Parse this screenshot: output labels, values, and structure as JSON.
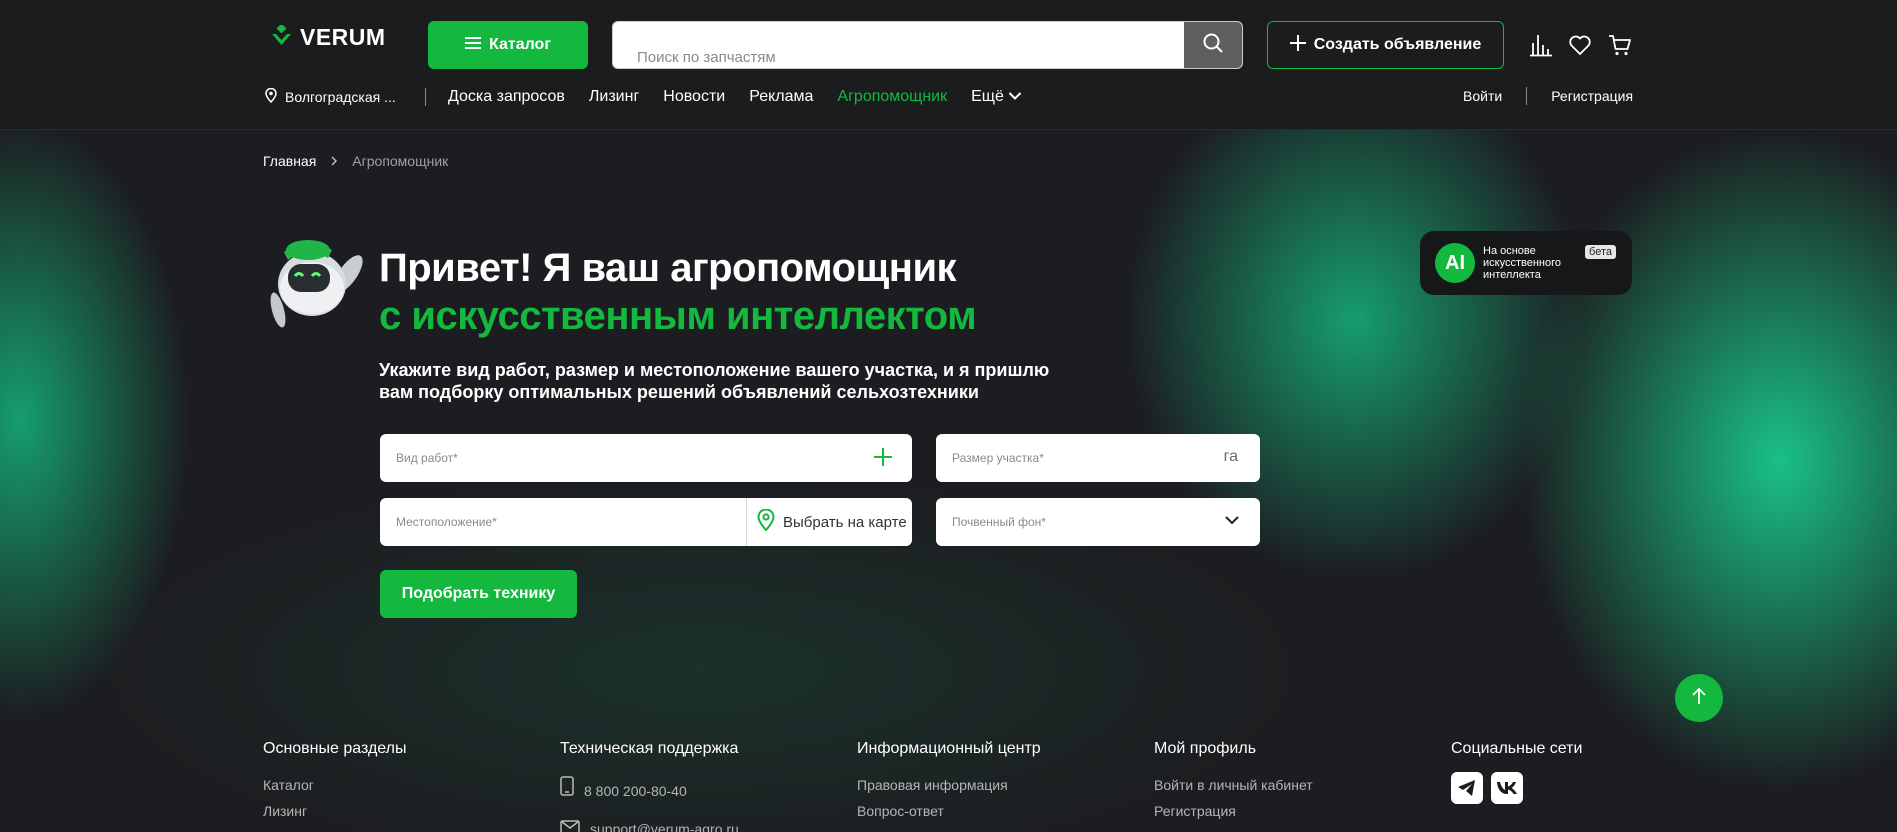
{
  "header": {
    "logo_text": "VERUM",
    "catalog_label": "Каталог",
    "search_placeholder": "Поиск по запчастям",
    "create_label": "Создать объявление",
    "region": "Волгоградская ...",
    "nav": [
      "Доска запросов",
      "Лизинг",
      "Новости",
      "Реклама",
      "Агропомощник"
    ],
    "nav_more": "Ещё",
    "login": "Войти",
    "register": "Регистрация"
  },
  "breadcrumb": {
    "home": "Главная",
    "current": "Агропомощник"
  },
  "hero": {
    "title_line1": "Привет! Я ваш агропомощник",
    "title_line2": "с искусственным интеллектом",
    "subtitle": "Укажите вид работ, размер и местоположение вашего участка, и я пришлю вам подборку оптимальных решений объявлений сельхозтехники"
  },
  "ai_badge": {
    "circle": "AI",
    "text": "На основе искусственного интеллекта",
    "beta": "бета"
  },
  "form": {
    "work_placeholder": "Вид работ*",
    "size_placeholder": "Размер участка*",
    "size_unit": "га",
    "location_placeholder": "Местоположение*",
    "map_label": "Выбрать на карте",
    "soil_placeholder": "Почвенный фон*",
    "submit_label": "Подобрать технику"
  },
  "footer": {
    "sections_title": "Основные разделы",
    "sections": [
      "Каталог",
      "Лизинг"
    ],
    "support_title": "Техническая поддержка",
    "phone": "8 800 200-80-40",
    "email": "support@verum-agro.ru",
    "info_title": "Информационный центр",
    "info": [
      "Правовая информация",
      "Вопрос-ответ"
    ],
    "profile_title": "Мой профиль",
    "profile": [
      "Войти в личный кабинет",
      "Регистрация"
    ],
    "social_title": "Социальные сети"
  },
  "colors": {
    "accent": "#14b83f",
    "background": "#1b1c1e"
  },
  "icons": [
    "logo-mark-icon",
    "menu-icon",
    "search-icon",
    "plus-icon",
    "stats-icon",
    "heart-icon",
    "cart-icon",
    "location-pin-icon",
    "chevron-down-icon",
    "chevron-right-icon",
    "arrow-up-icon",
    "phone-icon",
    "mail-icon",
    "telegram-icon",
    "vk-icon"
  ]
}
